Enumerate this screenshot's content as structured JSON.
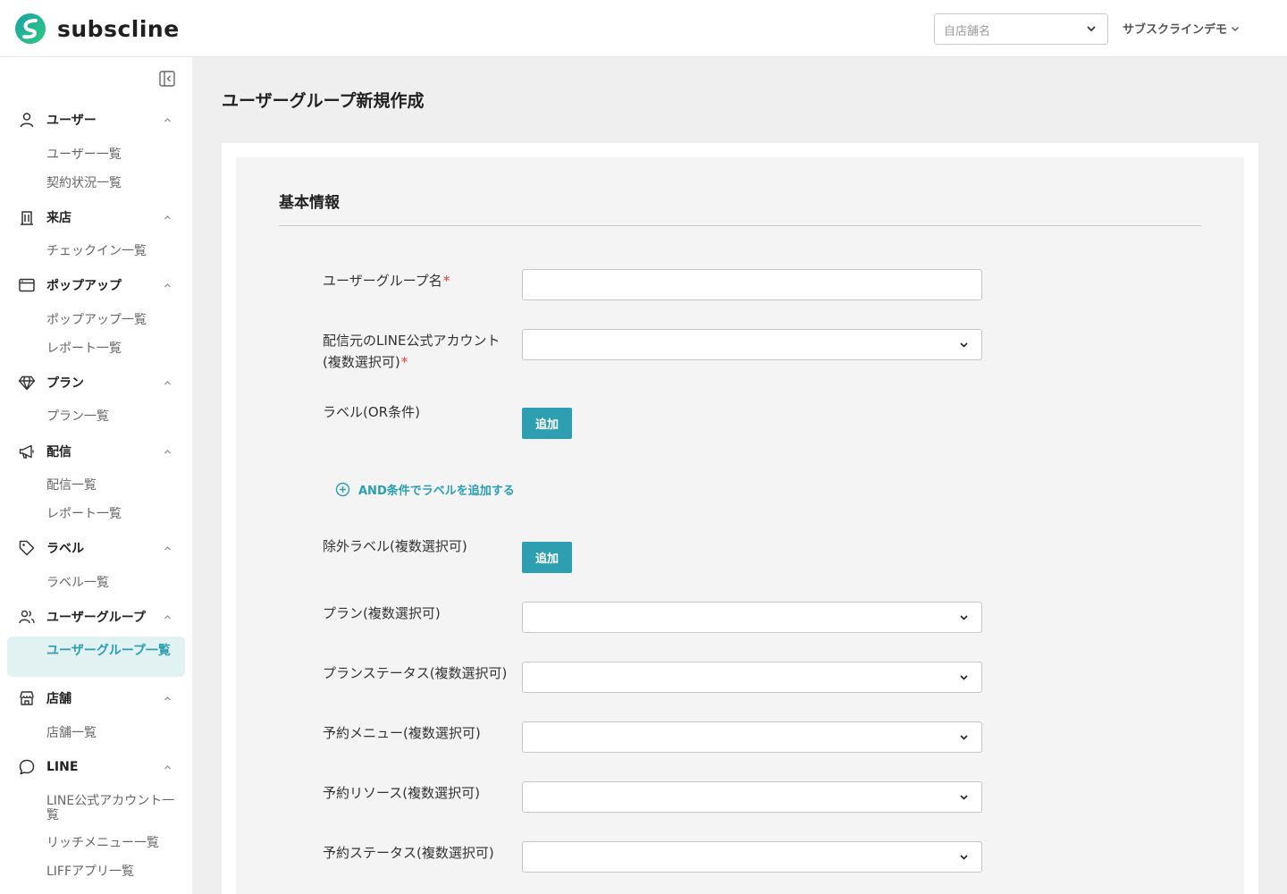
{
  "header": {
    "logo_text": "subscline",
    "store_select_placeholder": "自店舗名",
    "account_name": "サブスクラインデモ"
  },
  "sidebar": {
    "sections": [
      {
        "label": "ユーザー",
        "icon": "person-icon",
        "items": [
          "ユーザー一覧",
          "契約状況一覧"
        ]
      },
      {
        "label": "来店",
        "icon": "building-icon",
        "items": [
          "チェックイン一覧"
        ]
      },
      {
        "label": "ポップアップ",
        "icon": "window-icon",
        "items": [
          "ポップアップ一覧",
          "レポート一覧"
        ]
      },
      {
        "label": "プラン",
        "icon": "diamond-icon",
        "items": [
          "プラン一覧"
        ]
      },
      {
        "label": "配信",
        "icon": "megaphone-icon",
        "items": [
          "配信一覧",
          "レポート一覧"
        ]
      },
      {
        "label": "ラベル",
        "icon": "tag-icon",
        "items": [
          "ラベル一覧"
        ]
      },
      {
        "label": "ユーザーグループ",
        "icon": "users-icon",
        "items": [
          "ユーザーグループ一覧"
        ]
      },
      {
        "label": "店舗",
        "icon": "store-icon",
        "items": [
          "店舗一覧"
        ]
      },
      {
        "label": "LINE",
        "icon": "chat-bubble-icon",
        "items": [
          "LINE公式アカウント一覧",
          "リッチメニュー一覧",
          "LIFFアプリ一覧"
        ]
      }
    ],
    "active_item": "ユーザーグループ一覧"
  },
  "main": {
    "page_title": "ユーザーグループ新規作成",
    "section_title": "基本情報",
    "fields": {
      "group_name": {
        "label": "ユーザーグループ名",
        "required_mark": "*",
        "value": ""
      },
      "line_account": {
        "label_line1": "配信元のLINE公式アカウント",
        "label_line2": "(複数選択可)",
        "required_mark": "*",
        "value": ""
      },
      "label_or": {
        "label": "ラベル(OR条件)",
        "button": "追加"
      },
      "and_link": "AND条件でラベルを追加する",
      "exclude_label": {
        "label": "除外ラベル(複数選択可)",
        "button": "追加"
      },
      "plan": {
        "label": "プラン(複数選択可)",
        "value": ""
      },
      "plan_status": {
        "label": "プランステータス(複数選択可)",
        "value": ""
      },
      "reserve_menu": {
        "label": "予約メニュー(複数選択可)",
        "value": ""
      },
      "reserve_resource": {
        "label": "予約リソース(複数選択可)",
        "value": ""
      },
      "reserve_status": {
        "label": "予約ステータス(複数選択可)",
        "value": ""
      }
    }
  },
  "colors": {
    "accent": "#2d9fb1",
    "active_bg": "#e2f2f3",
    "required": "#e53935",
    "page_bg": "#efefef",
    "panel_bg": "#f4f4f4"
  }
}
